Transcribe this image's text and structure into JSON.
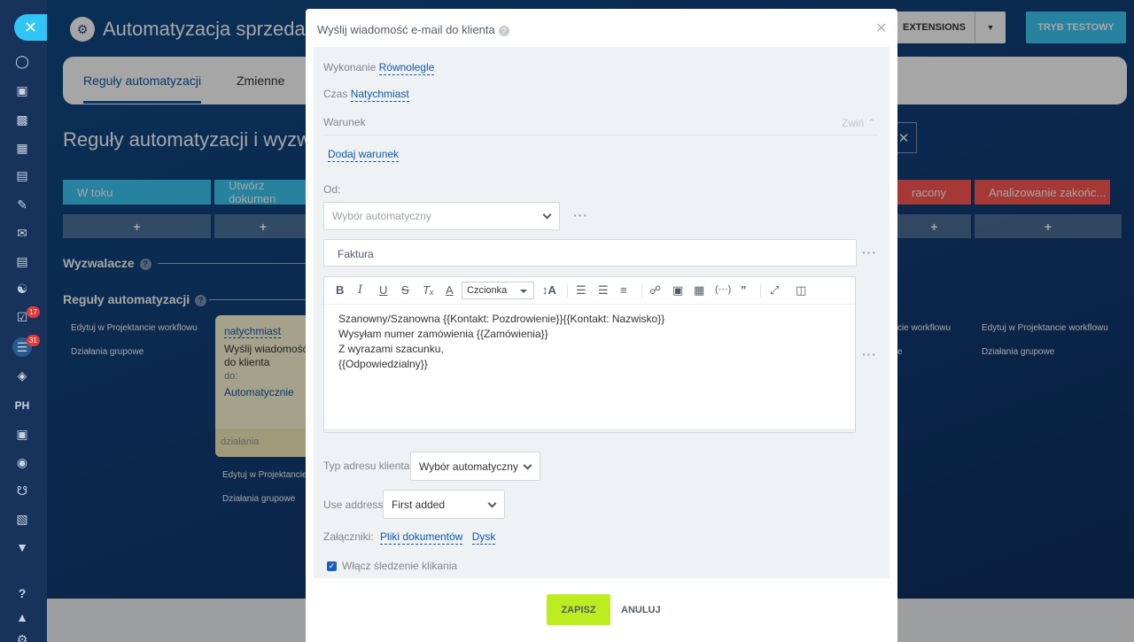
{
  "header": {
    "title": "Automatyzacja sprzedaży",
    "extensions_label": "EXTENSIONS",
    "test_mode_label": "TRYB TESTOWY"
  },
  "sidebar": {
    "items": [
      {
        "icon": "crm-icon"
      },
      {
        "icon": "feed-icon"
      },
      {
        "icon": "chat-icon"
      },
      {
        "icon": "calendar-icon"
      },
      {
        "icon": "document-icon"
      },
      {
        "icon": "signature-icon"
      },
      {
        "icon": "mail-icon"
      },
      {
        "icon": "inbox-icon"
      },
      {
        "icon": "contacts-icon"
      },
      {
        "icon": "tasks-icon",
        "badge": "17"
      },
      {
        "icon": "filter-icon",
        "badge": "31"
      },
      {
        "icon": "box-icon"
      },
      {
        "icon": "hr-icon",
        "label": "PH"
      },
      {
        "icon": "robot-icon"
      },
      {
        "icon": "target-icon"
      },
      {
        "icon": "cart-icon"
      },
      {
        "icon": "id-card-icon"
      },
      {
        "icon": "chevron-down-circle-icon"
      },
      {
        "icon": "help-icon"
      },
      {
        "icon": "structure-icon"
      },
      {
        "icon": "settings-icon"
      }
    ]
  },
  "tabs": [
    {
      "label": "Reguły automatyzacji"
    },
    {
      "label": "Zmienne"
    }
  ],
  "page": {
    "section_title": "Reguły automatyzacji i wyzw",
    "stages": [
      "W toku",
      "Utwórz dokumen",
      "racony",
      "Analizowanie zakońc..."
    ],
    "triggers_label": "Wyzwalacze",
    "rules_label": "Reguły automatyzacji",
    "edit_in_designer": "Edytuj w Projektancie workflowu",
    "edit_in_designer_short": "Edytuj w Projektancie",
    "edit_designer_right_cut": "cie workflowu",
    "group_actions": "Działania grupowe",
    "group_actions_cut": "e",
    "card": {
      "when": "natychmiast",
      "what": "Wyślij wiadomość do klienta",
      "to": "do:",
      "auto": "Automatycznie",
      "foot": "działania"
    }
  },
  "modal": {
    "title": "Wyślij wiadomość e-mail do klienta",
    "execution_label": "Wykonanie",
    "execution_value": "Równolegle",
    "time_label": "Czas",
    "time_value": "Natychmiast",
    "condition_label": "Warunek",
    "collapse_label": "Zwiń",
    "add_condition": "Dodaj warunek",
    "from_label": "Od:",
    "from_placeholder": "Wybór automatyczny",
    "subject_value": "Faktura",
    "font_select": "Czcionka",
    "body_lines": [
      "Szanowny/Szanowna {{Kontakt: Pozdrowienie}}{{Kontakt: Nazwisko}}",
      "Wysyłam numer zamówienia {{Zamówienia}}",
      "Z wyrazami szacunku,",
      "{{Odpowiedzialny}}"
    ],
    "address_type_label": "Typ adresu klienta:",
    "address_type_value": "Wybór automatyczny",
    "use_address_label": "Use address:",
    "use_address_value": "First added",
    "attachments_label": "Załączniki:",
    "attachment_docs": "Pliki dokumentów",
    "attachment_disk": "Dysk",
    "tracking_label": "Włącz śledzenie klikania",
    "save_label": "ZAPISZ",
    "cancel_label": "ANULUJ"
  },
  "colors": {
    "accent": "#1058a6",
    "save_green": "#bbed21",
    "stage_blue": "#3bc8f5",
    "stage_red": "#ff5752"
  }
}
